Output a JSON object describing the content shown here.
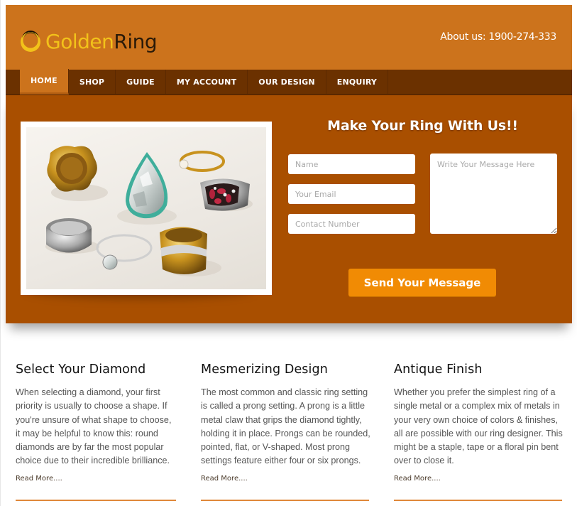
{
  "brand": {
    "name_part1": "Golden",
    "name_part2": "Ring",
    "icon": "ring-logo-icon",
    "colors": {
      "header": "#cc731c",
      "nav": "#6b3100",
      "hero": "#a94f00",
      "accent": "#f18b04",
      "logo_gold": "#f2c21a"
    }
  },
  "header": {
    "contact": "About us: 1900-274-333"
  },
  "nav": {
    "items": [
      {
        "label": "HOME",
        "active": true
      },
      {
        "label": "SHOP",
        "active": false
      },
      {
        "label": "GUIDE",
        "active": false
      },
      {
        "label": "MY ACCOUNT",
        "active": false
      },
      {
        "label": "OUR DESIGN",
        "active": false
      },
      {
        "label": "ENQUIRY",
        "active": false
      }
    ]
  },
  "hero": {
    "image_alt": "Assorted gold and silver rings with gemstones",
    "title": "Make Your Ring With Us!!",
    "form": {
      "name_placeholder": "Name",
      "name_value": "",
      "email_placeholder": "Your Email",
      "email_value": "",
      "phone_placeholder": "Contact Number",
      "phone_value": "",
      "message_placeholder": "Write Your Message Here",
      "message_value": "",
      "submit_label": "Send Your Message"
    }
  },
  "features": [
    {
      "title": "Select Your Diamond",
      "body": "When selecting a diamond, your first priority is usually to choose a shape. If you're unsure of what shape to choose, it may be helpful to know this: round diamonds are by far the most popular choice due to their incredible brilliance.",
      "link": "Read More...."
    },
    {
      "title": "Mesmerizing Design",
      "body": "The most common and classic ring setting is called a prong setting. A prong is a little metal claw that grips the diamond tightly, holding it in place. Prongs can be rounded, pointed, flat, or V-shaped. Most prong settings feature either four or six prongs.",
      "link": "Read More...."
    },
    {
      "title": "Antique Finish",
      "body": "Whether you prefer the simplest ring of a single metal or a complex mix of metals in your very own choice of colors & finishes, all are possible with our ring designer. This might be a staple, tape or a floral pin bent over to close it.",
      "link": "Read More...."
    }
  ]
}
